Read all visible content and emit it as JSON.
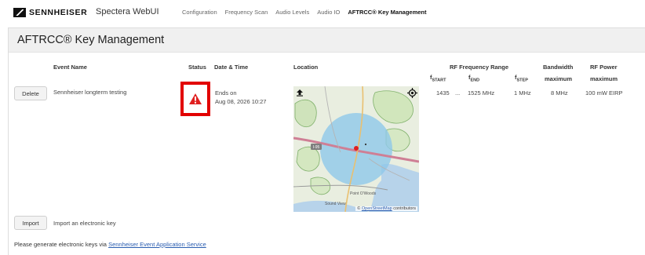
{
  "brand": {
    "logo_text": "SENNHEISER",
    "app_title": "Spectera WebUI"
  },
  "nav": {
    "items": [
      "Configuration",
      "Frequency Scan",
      "Audio Levels",
      "Audio IO",
      "AFTRCC® Key Management"
    ],
    "active_index": 4
  },
  "page": {
    "title": "AFTRCC® Key Management"
  },
  "table": {
    "headers": {
      "event_name": "Event Name",
      "status": "Status",
      "date_time": "Date & Time",
      "location": "Location",
      "rf_range": "RF Frequency Range",
      "bandwidth": "Bandwidth",
      "bandwidth_sub": "maximum",
      "rf_power": "RF Power",
      "rf_power_sub": "maximum",
      "f_start": "f",
      "f_start_sub": "START",
      "f_end": "f",
      "f_end_sub": "END",
      "f_step": "f",
      "f_step_sub": "STEP"
    },
    "row": {
      "delete_label": "Delete",
      "event_name": "Sennheiser longterm testing",
      "status_icon": "warning-icon",
      "ends_on_label": "Ends on",
      "ends_on_value": "Aug 08, 2026 10:27",
      "f_start": "1435",
      "range_sep": "...",
      "f_end": "1525 MHz",
      "f_step": "1 MHz",
      "bandwidth": "8 MHz",
      "rf_power": "100 mW EIRP"
    }
  },
  "map": {
    "credit_prefix": "©",
    "credit_link": "OpenStreetMap",
    "credit_suffix": "contributors",
    "labels": {
      "road_shield": "I-95",
      "town": "Sound View",
      "place": "Point O'Woods"
    }
  },
  "import": {
    "button_label": "Import",
    "description": "Import an electronic key"
  },
  "footer": {
    "prefix": "Please generate electronic keys via",
    "link": "Sennheiser Event Application Service"
  },
  "colors": {
    "status_highlight": "#e20000",
    "warning": "#e02020",
    "link": "#2a5db0",
    "coverage": "#8ec8ea"
  }
}
